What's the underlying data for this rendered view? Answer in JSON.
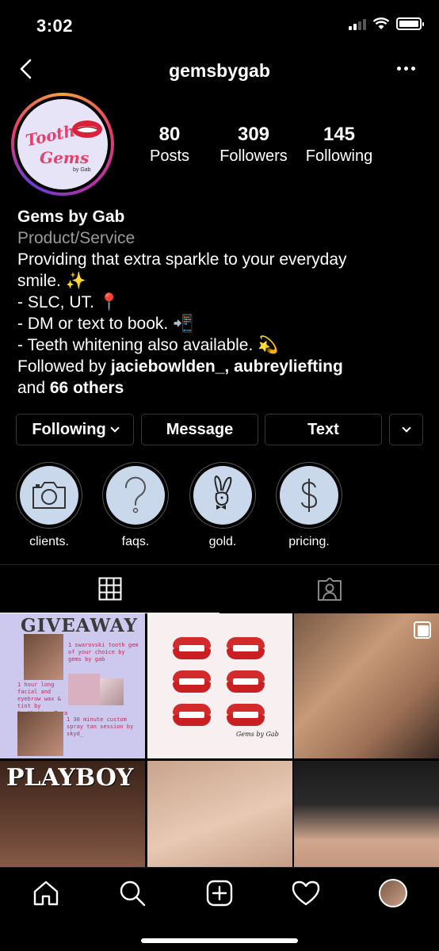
{
  "status_bar": {
    "time": "3:02"
  },
  "header": {
    "username": "gemsbygab"
  },
  "profile": {
    "avatar_text": {
      "line1": "Tooth",
      "line2": "Gems",
      "line3": "by Gab"
    },
    "stats": [
      {
        "value": "80",
        "label": "Posts"
      },
      {
        "value": "309",
        "label": "Followers"
      },
      {
        "value": "145",
        "label": "Following"
      }
    ]
  },
  "bio": {
    "name": "Gems by Gab",
    "category": "Product/Service",
    "lines": [
      "Providing that extra sparkle to your everyday",
      "smile. ✨",
      "- SLC, UT. 📍",
      "- DM or text to book. 📲",
      "- Teeth whitening also available. 💫"
    ],
    "followed_prefix": "Followed by ",
    "followed_names": "jaciebowlden_, aubreyliefting",
    "followed_and": "and ",
    "followed_others": "66 others"
  },
  "buttons": {
    "following": "Following",
    "message": "Message",
    "text": "Text"
  },
  "highlights": [
    {
      "label": "clients.",
      "icon": "camera-icon"
    },
    {
      "label": "faqs.",
      "icon": "question-icon"
    },
    {
      "label": "gold.",
      "icon": "bunny-icon"
    },
    {
      "label": "pricing.",
      "icon": "dollar-icon"
    }
  ],
  "posts": {
    "giveaway": {
      "title": "GIVEAWAY",
      "item1": "1 swarovski tooth gem of your choice by gems by gab",
      "item2": "1 hour long facial and eyebrow wax & tint by Aesthetics_Tyra",
      "item3": "1 30 minute custom spray tan session by skyd_"
    },
    "lips_signature": "Gems by Gab",
    "playboy_title": "PLAYBOY"
  },
  "colors": {
    "background": "#000000",
    "highlight_circle": "#c9d8ea",
    "border": "#363636",
    "category_gray": "#9a9a9a"
  }
}
